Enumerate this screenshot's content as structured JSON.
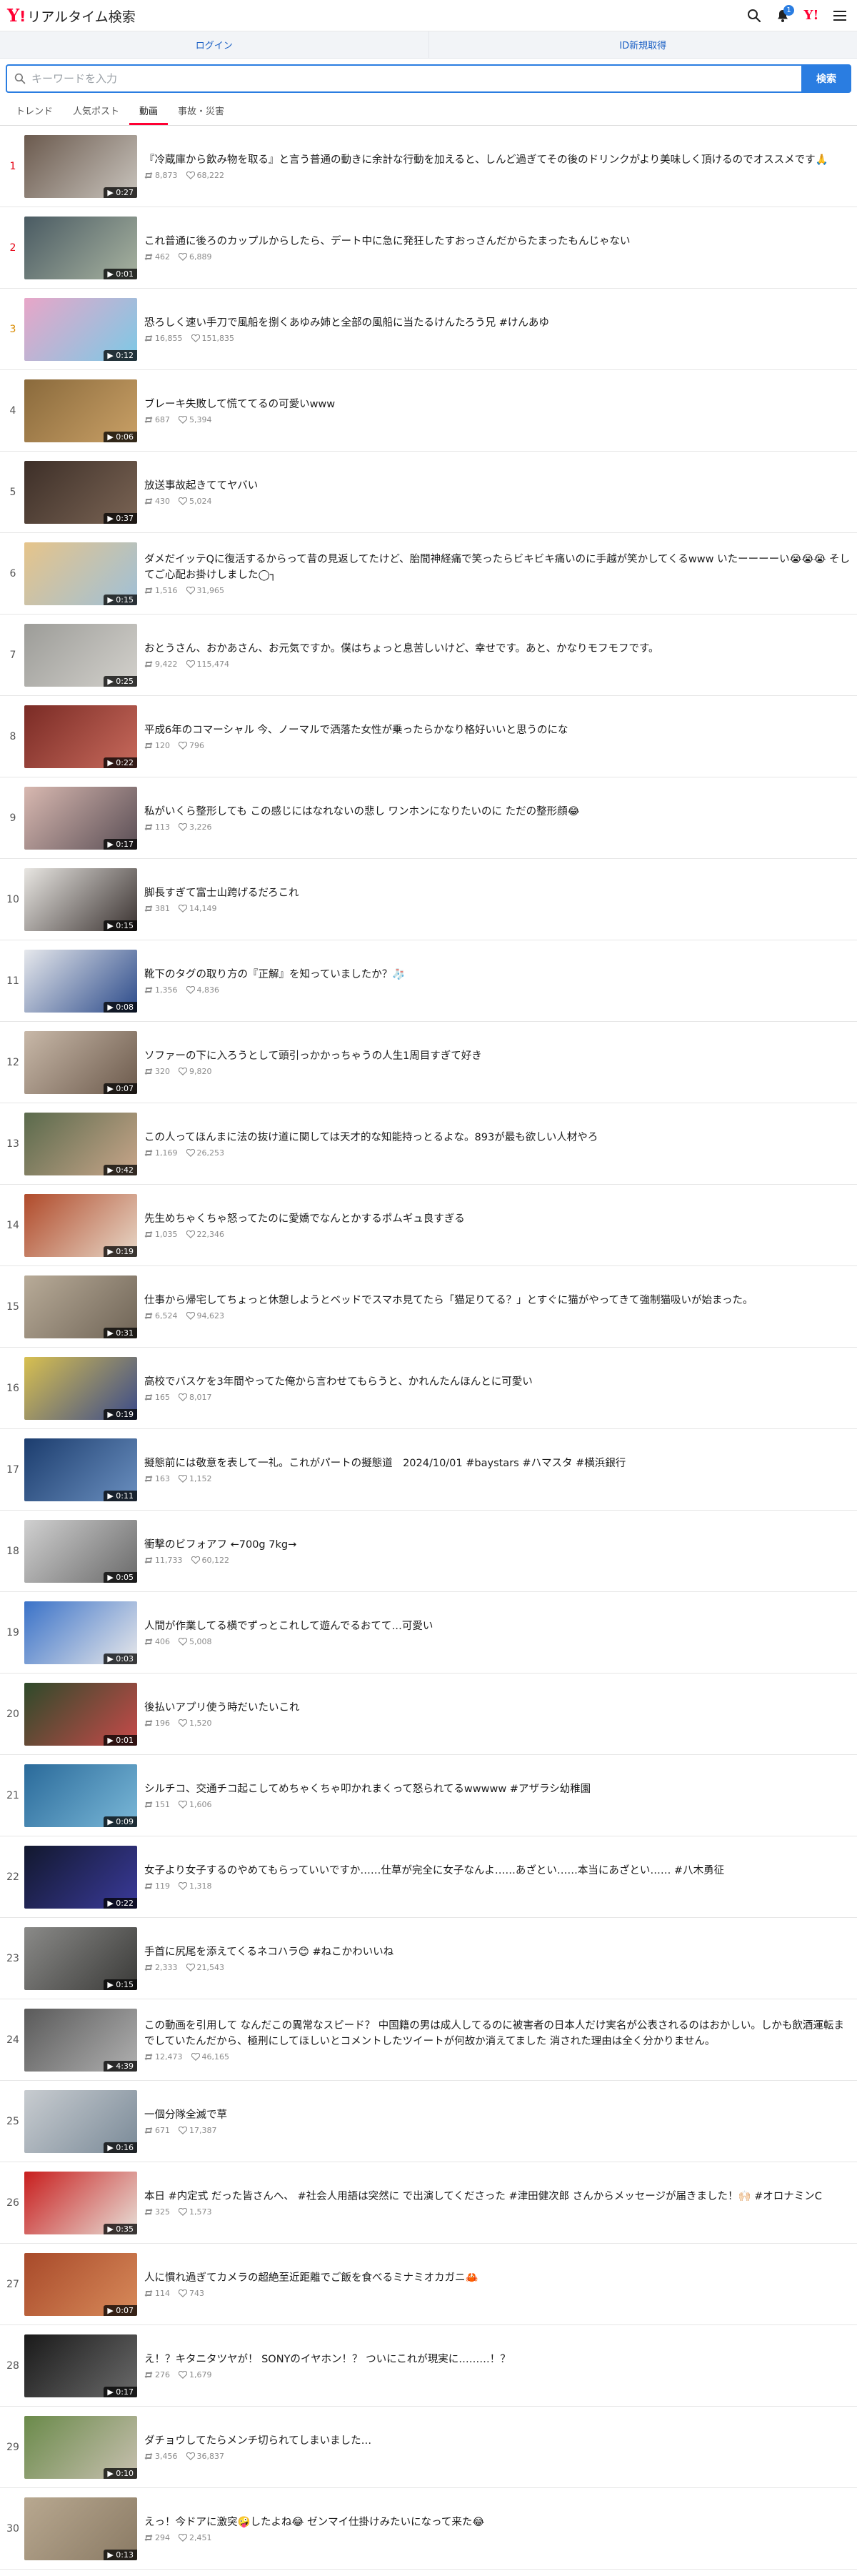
{
  "header": {
    "logo_y": "Y",
    "logo_bang": "!",
    "logo_text": "リアルタイム検索",
    "notification_count": "1",
    "yj_logo": "Y!"
  },
  "login": {
    "login_label": "ログイン",
    "register_label": "ID新規取得"
  },
  "search": {
    "placeholder": "キーワードを入力",
    "button_label": "検索"
  },
  "tabs": [
    {
      "label": "トレンド"
    },
    {
      "label": "人気ポスト"
    },
    {
      "label": "動画"
    },
    {
      "label": "事故・災害"
    }
  ],
  "items": [
    {
      "rank": "1",
      "duration": "0:27",
      "title": "『冷蔵庫から飲み物を取る』と言う普通の動きに余計な行動を加えると、しんど過ぎてその後のドリンクがより美味しく頂けるのでオススメです🙏",
      "reposts": "8,873",
      "likes": "68,222",
      "colors": [
        "#6b5a4e",
        "#c9c4bd"
      ]
    },
    {
      "rank": "2",
      "duration": "0:01",
      "title": "これ普通に後ろのカップルからしたら、デート中に急に発狂したすおっさんだからたまったもんじゃない",
      "reposts": "462",
      "likes": "6,889",
      "colors": [
        "#4a5b63",
        "#a8b3a0"
      ]
    },
    {
      "rank": "3",
      "duration": "0:12",
      "title": "恐ろしく速い手刀で風船を捌くあゆみ姉と全部の風船に当たるけんたろう兄 #けんあゆ",
      "reposts": "16,855",
      "likes": "151,835",
      "colors": [
        "#e8a6c8",
        "#7cc9e6"
      ]
    },
    {
      "rank": "4",
      "duration": "0:06",
      "title": "ブレーキ失敗して慌ててるの可愛いwww",
      "reposts": "687",
      "likes": "5,394",
      "colors": [
        "#8a6a3c",
        "#c9a066"
      ]
    },
    {
      "rank": "5",
      "duration": "0:37",
      "title": "放送事故起きててヤバい",
      "reposts": "430",
      "likes": "5,024",
      "colors": [
        "#3d2f28",
        "#7a6454"
      ]
    },
    {
      "rank": "6",
      "duration": "0:15",
      "title": "ダメだイッテQに復活するからって昔の見返してたけど、胎間神経痛で笑ったらビキビキ痛いのに手越が笑かしてくるwww いたーーーーい😭😭😭 そしてご心配お掛けしました◯┐",
      "reposts": "1,516",
      "likes": "31,965",
      "colors": [
        "#e6c48a",
        "#9fc0d8"
      ]
    },
    {
      "rank": "7",
      "duration": "0:25",
      "title": "おとうさん、おかあさん、お元気ですか。僕はちょっと息苦しいけど、幸せです。あと、かなりモフモフです。",
      "reposts": "9,422",
      "likes": "115,474",
      "colors": [
        "#9c9c98",
        "#d3d1cc"
      ]
    },
    {
      "rank": "8",
      "duration": "0:22",
      "title": "平成6年のコマーシャル 今、ノーマルで洒落た女性が乗ったらかなり格好いいと思うのにな",
      "reposts": "120",
      "likes": "796",
      "colors": [
        "#7a2b25",
        "#c86a5c"
      ]
    },
    {
      "rank": "9",
      "duration": "0:17",
      "title": "私がいくら整形しても この感じにはなれないの悲し ワンホンになりたいのに ただの整形顔😂",
      "reposts": "113",
      "likes": "3,226",
      "colors": [
        "#d8b8b0",
        "#5a4e55"
      ]
    },
    {
      "rank": "10",
      "duration": "0:15",
      "title": "脚長すぎて富士山跨げるだろこれ",
      "reposts": "381",
      "likes": "14,149",
      "colors": [
        "#e8e6e2",
        "#3a3230"
      ]
    },
    {
      "rank": "11",
      "duration": "0:08",
      "title": "靴下のタグの取り方の『正解』を知っていましたか？🧦",
      "reposts": "1,356",
      "likes": "4,836",
      "colors": [
        "#e6e8ec",
        "#2b4a8a"
      ]
    },
    {
      "rank": "12",
      "duration": "0:07",
      "title": "ソファーの下に入ろうとして頭引っかかっちゃうの人生1周目すぎて好き",
      "reposts": "320",
      "likes": "9,820",
      "colors": [
        "#c8b8a8",
        "#6c5a4c"
      ]
    },
    {
      "rank": "13",
      "duration": "0:42",
      "title": "この人ってほんまに法の抜け道に関しては天才的な知能持っとるよな。893が最も欲しい人材やろ",
      "reposts": "1,169",
      "likes": "26,253",
      "colors": [
        "#5a6a4c",
        "#c9a68a"
      ]
    },
    {
      "rank": "14",
      "duration": "0:19",
      "title": "先生めちゃくちゃ怒ってたのに愛嬌でなんとかするポムギュ良すぎる",
      "reposts": "1,035",
      "likes": "22,346",
      "colors": [
        "#b04a2a",
        "#e8d8c8"
      ]
    },
    {
      "rank": "15",
      "duration": "0:31",
      "title": "仕事から帰宅してちょっと休憩しようとベッドでスマホ見てたら「猫足りてる？」とすぐに猫がやってきて強制猫吸いが始まった。",
      "reposts": "6,524",
      "likes": "94,623",
      "colors": [
        "#b8ab98",
        "#6f6456"
      ]
    },
    {
      "rank": "16",
      "duration": "0:19",
      "title": "高校でバスケを3年間やってた俺から言わせてもらうと、かれんたんほんとに可愛い",
      "reposts": "165",
      "likes": "8,017",
      "colors": [
        "#d8c050",
        "#3a4a8a"
      ]
    },
    {
      "rank": "17",
      "duration": "0:11",
      "title": "擬態前には敬意を表して一礼。これがパートの擬態道　2024/10/01 #baystars #ハマスタ #横浜銀行",
      "reposts": "163",
      "likes": "1,152",
      "colors": [
        "#1c3d6e",
        "#6a8fbf"
      ]
    },
    {
      "rank": "18",
      "duration": "0:05",
      "title": "衝撃のビフォアフ ←700g 7kg→",
      "reposts": "11,733",
      "likes": "60,122",
      "colors": [
        "#d0d0d0",
        "#6a6a6a"
      ]
    },
    {
      "rank": "19",
      "duration": "0:03",
      "title": "人間が作業してる横でずっとこれして遊んでるおてて…可愛い",
      "reposts": "406",
      "likes": "5,008",
      "colors": [
        "#3a72c8",
        "#e8e8ea"
      ]
    },
    {
      "rank": "20",
      "duration": "0:01",
      "title": "後払いアプリ使う時だいたいこれ",
      "reposts": "196",
      "likes": "1,520",
      "colors": [
        "#2e4a2a",
        "#c84a4a"
      ]
    },
    {
      "rank": "21",
      "duration": "0:09",
      "title": "シルチコ、交通チコ起こしてめちゃくちゃ叩かれまくって怒られてるwwwww #アザラシ幼稚園",
      "reposts": "151",
      "likes": "1,606",
      "colors": [
        "#2a6a9a",
        "#7ab8d8"
      ]
    },
    {
      "rank": "22",
      "duration": "0:22",
      "title": "女子より女子するのやめてもらっていいですか……仕草が完全に女子なんよ……あざとい……本当にあざとい…… #八木勇征",
      "reposts": "119",
      "likes": "1,318",
      "colors": [
        "#12182e",
        "#3a3a9a"
      ]
    },
    {
      "rank": "23",
      "duration": "0:15",
      "title": "手首に尻尾を添えてくるネコハラ😊 #ねこかわいいね",
      "reposts": "2,333",
      "likes": "21,543",
      "colors": [
        "#8a8a88",
        "#3a3a38"
      ]
    },
    {
      "rank": "24",
      "duration": "4:39",
      "title": "この動画を引用して なんだこの異常なスピード？ 中国籍の男は成人してるのに被害者の日本人だけ実名が公表されるのはおかしい。しかも飲酒運転までしていたんだから、極刑にしてほしいとコメントしたツイートが何故か消えてました 消された理由は全く分かりません。",
      "reposts": "12,473",
      "likes": "46,165",
      "colors": [
        "#5a5a5a",
        "#b0b0b0"
      ]
    },
    {
      "rank": "25",
      "duration": "0:16",
      "title": "一個分隊全滅で草",
      "reposts": "671",
      "likes": "17,387",
      "colors": [
        "#c8ccd0",
        "#7a8a98"
      ]
    },
    {
      "rank": "26",
      "duration": "0:35",
      "title": "本日 #内定式 だった皆さんへ、 #社会人用語は突然に で出演してくださった #津田健次郎 さんからメッセージが届きました！🙌🏻 #オロナミンC",
      "reposts": "325",
      "likes": "1,573",
      "colors": [
        "#c81e1e",
        "#e8e0d8"
      ]
    },
    {
      "rank": "27",
      "duration": "0:07",
      "title": "人に慣れ過ぎてカメラの超絶至近距離でご飯を食べるミナミオカガニ🦀",
      "reposts": "114",
      "likes": "743",
      "colors": [
        "#a84a2a",
        "#d88a5a"
      ]
    },
    {
      "rank": "28",
      "duration": "0:17",
      "title": "え！？キタニタツヤが！ SONYのイヤホン！？ ついにこれが現実に………！？",
      "reposts": "276",
      "likes": "1,679",
      "colors": [
        "#1a1a1a",
        "#6a6a6a"
      ]
    },
    {
      "rank": "29",
      "duration": "0:10",
      "title": "ダチョウしてたらメンチ切られてしまいました…",
      "reposts": "3,456",
      "likes": "36,837",
      "colors": [
        "#6a8a4a",
        "#c8c0b0"
      ]
    },
    {
      "rank": "30",
      "duration": "0:13",
      "title": "えっ！今ドアに激突🤪したよね😂 ゼンマイ仕掛けみたいになって来た😂",
      "reposts": "294",
      "likes": "2,451",
      "colors": [
        "#b8a890",
        "#8a7a64"
      ]
    }
  ]
}
